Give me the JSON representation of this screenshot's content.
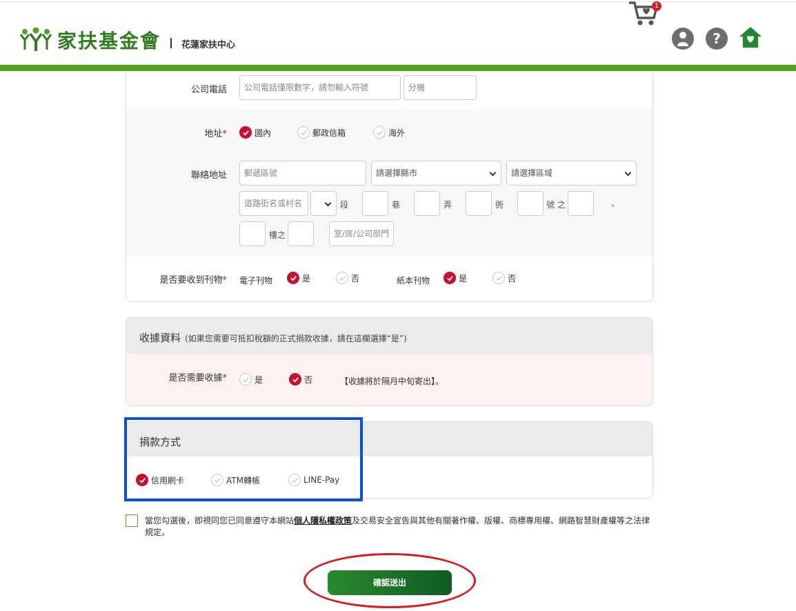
{
  "header": {
    "org_name": "家扶基金會",
    "center_name": "花蓮家扶中心",
    "cart_count": "1",
    "icons": [
      "cart-icon",
      "user-icon",
      "help-icon",
      "home-icon"
    ],
    "brand_color": "#56a022"
  },
  "contact": {
    "company_phone_label": "公司電話",
    "company_phone_placeholder": "公司電話僅限數字，請勿輸入符號",
    "extension_placeholder": "分機",
    "address_label": "地址",
    "address_options": [
      {
        "label": "國內",
        "checked": true
      },
      {
        "label": "郵政信箱",
        "checked": false
      },
      {
        "label": "海外",
        "checked": false
      }
    ],
    "mailing_label": "聯絡地址",
    "zip_placeholder": "郵遞區號",
    "city_select": "請選擇縣市",
    "district_select": "請選擇區域",
    "road_placeholder": "道路街名或村名",
    "section": "段",
    "lane": "巷",
    "alley": "弄",
    "sub_alley": "衖",
    "number_of": "號 之",
    "comma": "、",
    "floor_of": "樓之",
    "room_placeholder": "室/房/公司部門",
    "publication_label": "是否要收到刊物",
    "epub_label": "電子刊物",
    "epub_options": [
      {
        "label": "是",
        "checked": true
      },
      {
        "label": "否",
        "checked": false
      }
    ],
    "paper_label": "紙本刊物",
    "paper_options": [
      {
        "label": "是",
        "checked": true
      },
      {
        "label": "否",
        "checked": false
      }
    ]
  },
  "receipt": {
    "title": "收據資料",
    "note": "(如果您需要可抵扣稅額的正式捐款收據，請在這欄選擇“是”)",
    "need_label": "是否需要收據",
    "options": [
      {
        "label": "是",
        "checked": false
      },
      {
        "label": "否",
        "checked": true
      }
    ],
    "notice": "【收據將於隔月中旬寄出】。"
  },
  "payment": {
    "title": "捐款方式",
    "options": [
      {
        "label": "信用刷卡",
        "checked": true
      },
      {
        "label": "ATM轉帳",
        "checked": false
      },
      {
        "label": "LINE-Pay",
        "checked": false
      }
    ]
  },
  "agreement": {
    "text_before": "當您勾選後，即視同您已同意遵守本網站",
    "link": "個人隱私權政策",
    "text_after": "及交易安全宣告與其他有關著作權、版權、商標專用權、網路智慧財產權等之法律規定。",
    "checked": false
  },
  "submit_label": "確認送出",
  "colors": {
    "radio_checked": "#c8102e",
    "highlight_box": "#0a4fd6",
    "highlight_oval": "#d41c1c"
  }
}
